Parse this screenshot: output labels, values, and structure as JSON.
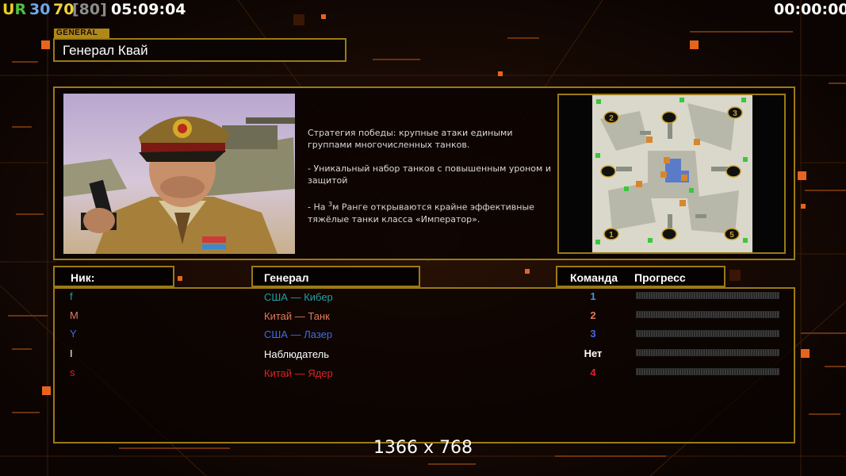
{
  "hud": {
    "ur": "UR",
    "n30": "30",
    "n70": "70",
    "n80": "[80]",
    "clock": "05:09:04",
    "timer": "00:00:00"
  },
  "general": {
    "tag": "GENERAL",
    "name": "Генерал Квай"
  },
  "description": {
    "para1": "Стратегия победы: крупные атаки едиными группами многочисленных танков.",
    "para2": "- Уникальный набор танков с повышенным уроном и защитой",
    "para3_prefix": "- На ",
    "para3_sup": "3",
    "para3_rest": "м Ранге открываются крайне эффективные тяжёлые танки класса «Император»."
  },
  "map": {
    "slots": [
      "2",
      "3",
      "1",
      "5"
    ]
  },
  "table": {
    "headers": {
      "nick": "Ник:",
      "general": "Генерал",
      "team": "Команда",
      "progress": "Прогресс"
    },
    "rows": [
      {
        "nick": "f",
        "general": "США — Кибер",
        "team": "1",
        "progress": 0,
        "color": "#1ea2a2",
        "team_color": "#3a9ad8"
      },
      {
        "nick": "M",
        "general": "Китай — Танк",
        "team": "2",
        "progress": 0,
        "color": "#e07a5a",
        "team_color": "#e07a5a"
      },
      {
        "nick": "Y",
        "general": "США — Лазер",
        "team": "3",
        "progress": 0,
        "color": "#3f6ae8",
        "team_color": "#3f6ae8"
      },
      {
        "nick": "I",
        "general": "Наблюдатель",
        "team": "Нет",
        "progress": 0,
        "color": "#ffffff",
        "team_color": "#ffffff"
      },
      {
        "nick": "s",
        "general": "Китай — Ядер",
        "team": "4",
        "progress": 0,
        "color": "#e0202a",
        "team_color": "#e0202a"
      }
    ]
  },
  "resolution": "1366 x 768",
  "colors": {
    "frame": "#9c7a14",
    "ur_u": "#e8d020",
    "ur_r": "#50c040",
    "n30": "#6fa8e8",
    "n70": "#f0d040",
    "n80": "#8c8c8c"
  }
}
